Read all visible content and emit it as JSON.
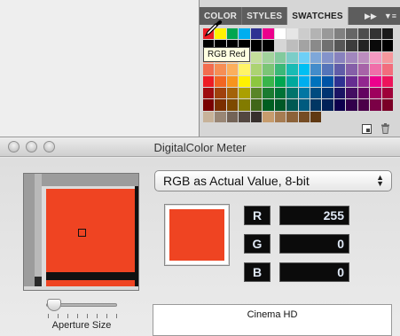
{
  "swatches_panel": {
    "tabs": [
      {
        "label": "COLOR",
        "active": false
      },
      {
        "label": "STYLES",
        "active": false
      },
      {
        "label": "SWATCHES",
        "active": true
      }
    ],
    "tooltip": "RGB Red",
    "icons": [
      "collapse-panel-icon",
      "panel-menu-icon",
      "new-swatch-icon",
      "trash-icon"
    ],
    "swatch_rows": [
      [
        "#ec1c24",
        "#fff200",
        "#00a651",
        "#00aeef",
        "#2e3192",
        "#ec008c",
        "#ffffff",
        "#e6e6e6",
        "#cccccc",
        "#b3b3b3",
        "#999999",
        "#808080",
        "#666666",
        "#4d4d4d",
        "#333333",
        "#1a1a1a"
      ],
      [
        "#000000",
        "#000000",
        "#000000",
        "#000000",
        "#000000",
        "#000000",
        "#d6d6d6",
        "#bdbdbd",
        "#a3a3a3",
        "#8a8a8a",
        "#707070",
        "#575757",
        "#3d3d3d",
        "#242424",
        "#0a0a0a",
        "#000000"
      ],
      [
        "#f7977a",
        "#f9ad81",
        "#fdc68a",
        "#fff79a",
        "#c4df9b",
        "#a2d39c",
        "#82ca9d",
        "#7bcdc8",
        "#6ecff6",
        "#7ea7d8",
        "#8493ca",
        "#8882be",
        "#a187be",
        "#bc8dbf",
        "#f49ac2",
        "#f6989d"
      ],
      [
        "#f26c4f",
        "#f68e55",
        "#fbaf5c",
        "#fff467",
        "#acd372",
        "#7cc576",
        "#3bb878",
        "#1abbb4",
        "#00bff3",
        "#438cca",
        "#5574b9",
        "#605ca8",
        "#855fa8",
        "#a763a8",
        "#f06ea9",
        "#f26d7d"
      ],
      [
        "#ed1c24",
        "#f26522",
        "#f7941d",
        "#fff200",
        "#8dc73f",
        "#39b54a",
        "#00a651",
        "#00a99d",
        "#00aeef",
        "#0072bc",
        "#0054a6",
        "#2e3192",
        "#662d91",
        "#92278f",
        "#ec008c",
        "#ed145b"
      ],
      [
        "#9e0b0f",
        "#a0410d",
        "#a36209",
        "#aba000",
        "#598527",
        "#1a7b30",
        "#007236",
        "#00746b",
        "#0076a3",
        "#004b80",
        "#003471",
        "#1b1464",
        "#440e62",
        "#630460",
        "#9e005d",
        "#9e0039"
      ],
      [
        "#790000",
        "#7b2e00",
        "#7d4900",
        "#827b00",
        "#406618",
        "#005e20",
        "#005826",
        "#005952",
        "#005b7f",
        "#003663",
        "#002157",
        "#0d004c",
        "#32004b",
        "#4b0049",
        "#7b0046",
        "#7a0026"
      ],
      [
        "#c7b299",
        "#998675",
        "#736357",
        "#534741",
        "#37302d",
        "#c69c6d",
        "#a67c52",
        "#8c6239",
        "#754c24",
        "#603913",
        "#d6d6d6",
        "#d6d6d6",
        "#d6d6d6",
        "#d6d6d6",
        "#d6d6d6",
        "#d6d6d6"
      ]
    ]
  },
  "dcm_window": {
    "title": "DigitalColor Meter",
    "mode_select": "RGB as Actual Value, 8-bit",
    "sample_color": "#ef4422",
    "channels": [
      {
        "label": "R",
        "value": "255"
      },
      {
        "label": "G",
        "value": "0"
      },
      {
        "label": "B",
        "value": "0"
      }
    ],
    "aperture_label": "Aperture Size",
    "aperture_level": 0.05,
    "display_name": "Cinema HD"
  }
}
